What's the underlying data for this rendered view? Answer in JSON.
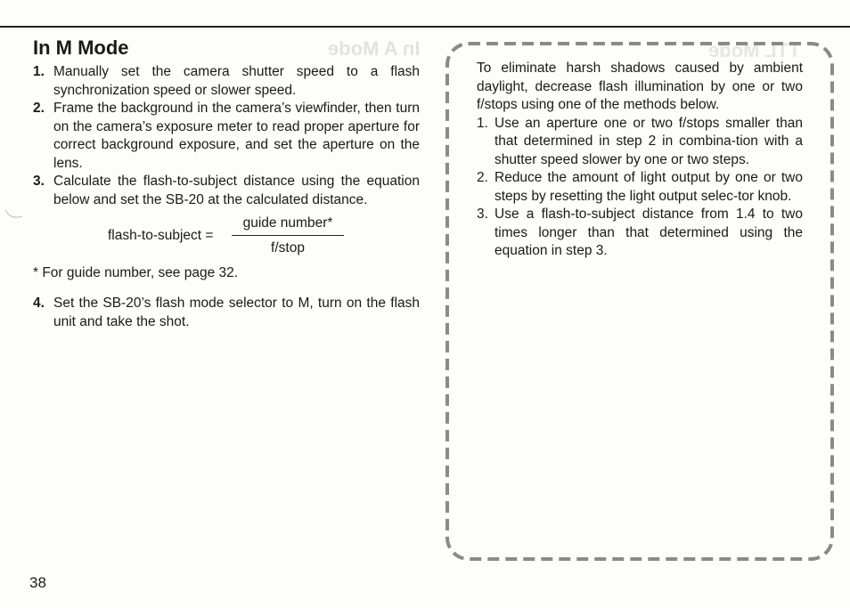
{
  "page": {
    "page_number": "38"
  },
  "left_section": {
    "title": "In M Mode",
    "steps": [
      {
        "num": "1.",
        "text": "Manually set the camera shutter speed to a flash synchronization speed or slower speed."
      },
      {
        "num": "2.",
        "text": "Frame the background in the camera’s viewfinder, then turn on the camera’s exposure meter to read proper aperture for correct background exposure, and set the aperture on the lens."
      },
      {
        "num": "3.",
        "text": "Calculate the flash-to-subject distance using the equation below and set the SB-20 at the calculated distance."
      },
      {
        "num": "4.",
        "text": "Set the SB-20’s flash mode selector to M, turn on the flash unit and take the shot."
      }
    ],
    "equation": {
      "lhs": "flash-to-subject =",
      "numerator": "guide number*",
      "denominator": "f/stop"
    },
    "footnote": "* For guide number, see page 32."
  },
  "note_box": {
    "intro": "To eliminate harsh shadows caused by ambient daylight, decrease flash illumination by one or two f/stops using one of the methods below.",
    "items": [
      {
        "num": "1.",
        "text": "Use an aperture one or two f/stops smaller than that determined in step 2 in combina-tion with a shutter speed slower by one or two steps."
      },
      {
        "num": "2.",
        "text": "Reduce the amount of light output by one or two steps by resetting the light output selec-tor knob."
      },
      {
        "num": "3.",
        "text": "Use a flash-to-subject distance from 1.4 to two times longer than that determined using the equation in step 3."
      }
    ]
  },
  "bleed_through": {
    "left_title": "In A Mode",
    "right_title": "TTL Mode"
  },
  "colors": {
    "text": "#1a1a1a",
    "dash_border": "#8a8a8a",
    "paper": "#fdfdfb"
  }
}
